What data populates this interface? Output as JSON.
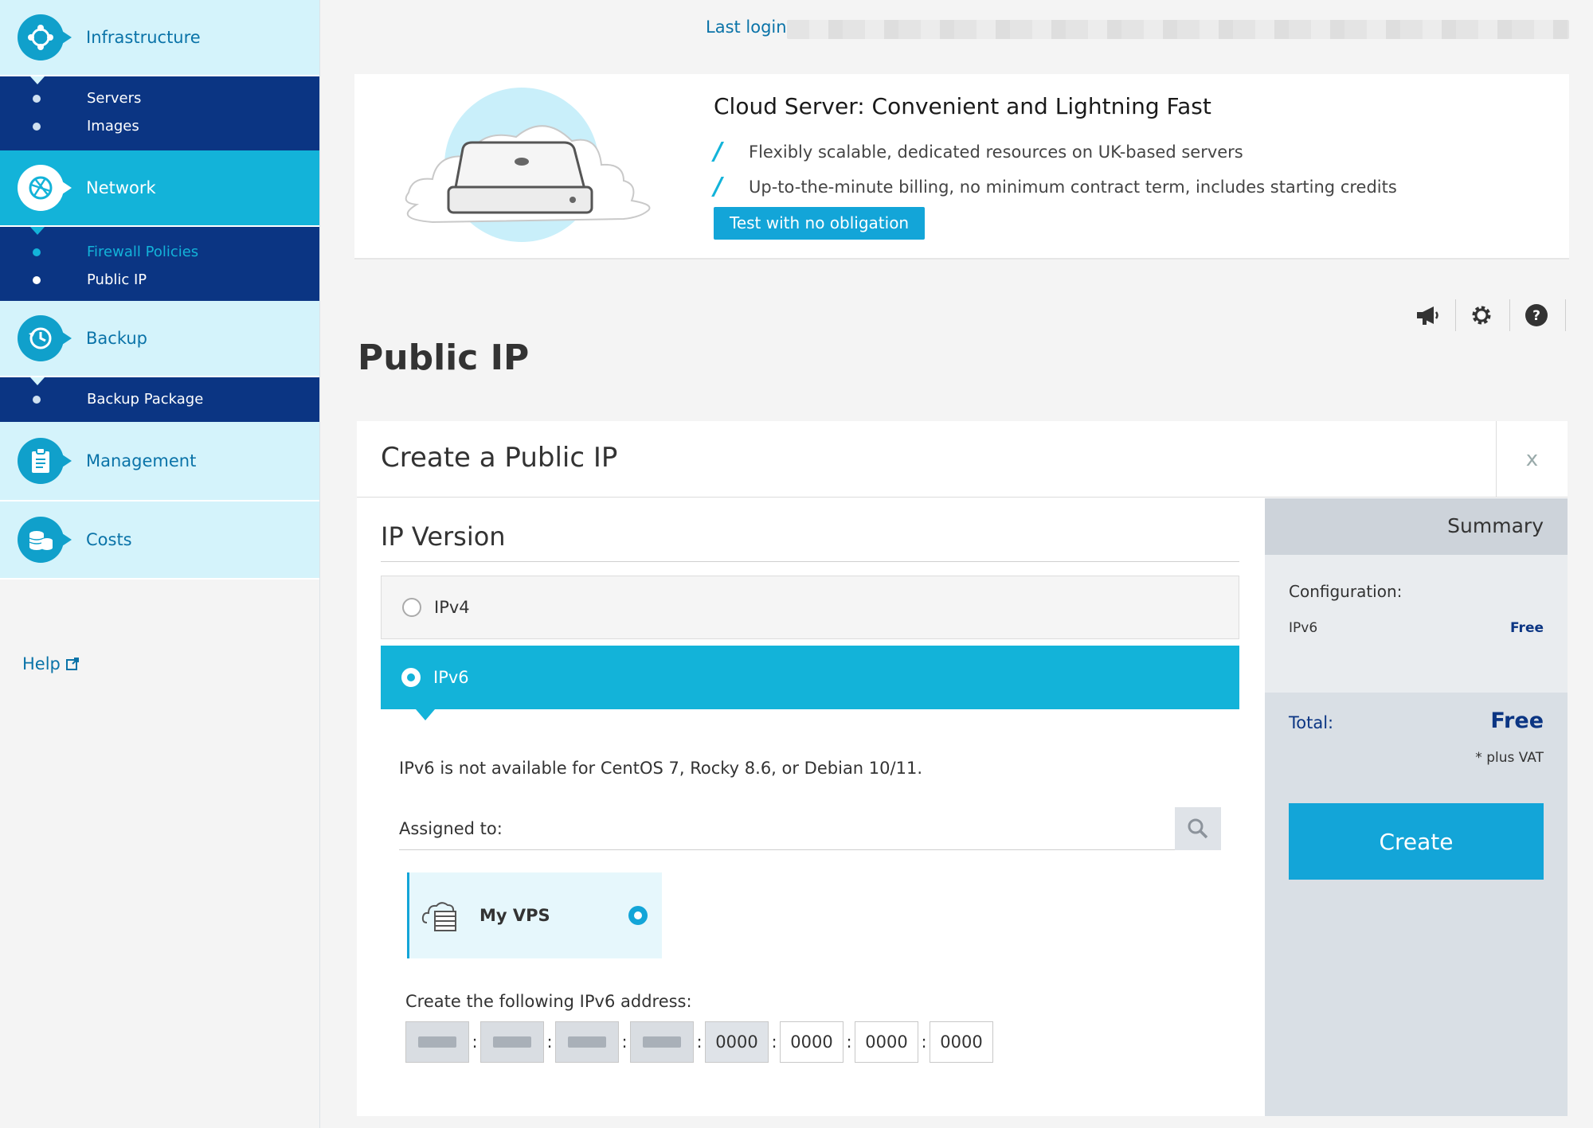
{
  "sidebar": {
    "sections": [
      {
        "label": "Infrastructure",
        "icon": "infrastructure-icon",
        "items": [
          "Servers",
          "Images"
        ]
      },
      {
        "label": "Network",
        "icon": "network-globe-icon",
        "active": true,
        "items": [
          "Firewall Policies",
          "Public IP"
        ]
      },
      {
        "label": "Backup",
        "icon": "backup-clock-icon",
        "items": [
          "Backup Package"
        ]
      },
      {
        "label": "Management",
        "icon": "clipboard-icon",
        "items": []
      },
      {
        "label": "Costs",
        "icon": "coins-icon",
        "items": []
      }
    ],
    "help_label": "Help"
  },
  "header": {
    "last_login_label": "Last login:"
  },
  "banner": {
    "title": "Cloud Server: Convenient and Lightning Fast",
    "bullets": [
      "Flexibly scalable, dedicated resources on UK-based servers",
      "Up-to-the-minute billing, no minimum contract term, includes starting credits"
    ],
    "button_label": "Test with no obligation"
  },
  "page": {
    "title": "Public IP"
  },
  "panel": {
    "title": "Create a Public IP",
    "close_label": "x",
    "section_title": "IP Version",
    "options": [
      {
        "label": "IPv4",
        "selected": false
      },
      {
        "label": "IPv6",
        "selected": true
      }
    ],
    "note": "IPv6 is not available for CentOS 7, Rocky 8.6, or Debian 10/11.",
    "assigned_label": "Assigned to:",
    "server_name": "My VPS",
    "ipv6_label": "Create the following IPv6 address:",
    "ipv6_segments": [
      "",
      "",
      "",
      "",
      "0000",
      "0000",
      "0000",
      "0000"
    ],
    "ipv6_separator": ":"
  },
  "summary": {
    "title": "Summary",
    "config_label": "Configuration:",
    "config_name": "IPv6",
    "config_price": "Free",
    "total_label": "Total:",
    "total_value": "Free",
    "vat_note": "* plus VAT",
    "create_label": "Create"
  },
  "colors": {
    "accent": "#13b3d9",
    "button": "#13a5d8",
    "navy": "#0b3583",
    "sidebar_light": "#d4f3fb"
  }
}
